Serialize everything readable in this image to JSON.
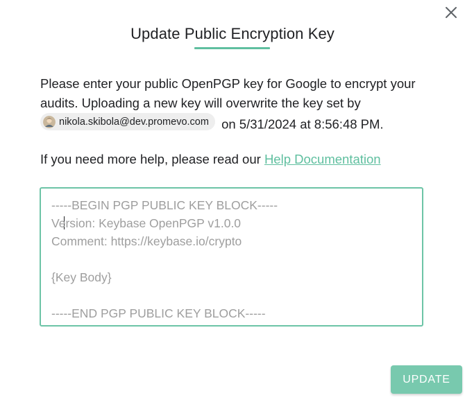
{
  "dialog": {
    "title": "Update Public Encryption Key",
    "close_icon": "close-icon",
    "accent_color": "#5fbf9f"
  },
  "message": {
    "line1": "Please enter your public OpenPGP key for Google to encrypt your audits. Uploading a new key will overwrite the key set by",
    "user_email": "nikola.skibola@dev.promevo.com",
    "suffix": "on 5/31/2024 at 8:56:48 PM."
  },
  "help": {
    "prefix": "If you need more help, please read our ",
    "link_text": "Help Documentation"
  },
  "key_input": {
    "value": "",
    "placeholder": "-----BEGIN PGP PUBLIC KEY BLOCK-----\nVersion: Keybase OpenPGP v1.0.0\nComment: https://keybase.io/crypto\n\n{Key Body}\n\n-----END PGP PUBLIC KEY BLOCK-----"
  },
  "actions": {
    "update_label": "UPDATE"
  }
}
